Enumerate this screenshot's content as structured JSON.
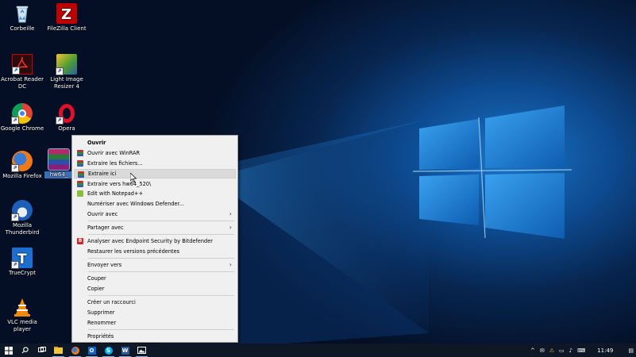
{
  "desktop": {
    "icons": [
      {
        "label": "Corbeille",
        "icon": "recycle-bin-icon"
      },
      {
        "label": "FileZilla Client",
        "icon": "filezilla-icon"
      },
      {
        "label": "Acrobat Reader DC",
        "icon": "acrobat-icon"
      },
      {
        "label": "Light Image Resizer 4",
        "icon": "light-image-resizer-icon"
      },
      {
        "label": "Google Chrome",
        "icon": "chrome-icon"
      },
      {
        "label": "Opera",
        "icon": "opera-icon"
      },
      {
        "label": "Mozilla Firefox",
        "icon": "firefox-icon"
      },
      {
        "label": "hw64_",
        "icon": "winrar-archive-icon"
      },
      {
        "label": "Mozilla Thunderbird",
        "icon": "thunderbird-icon"
      },
      {
        "label": "TrueCrypt",
        "icon": "truecrypt-icon"
      },
      {
        "label": "VLC media player",
        "icon": "vlc-icon"
      }
    ]
  },
  "context_menu": {
    "items": [
      {
        "label": "Ouvrir"
      },
      {
        "label": "Ouvrir avec WinRAR"
      },
      {
        "label": "Extraire les fichiers..."
      },
      {
        "label": "Extraire ici"
      },
      {
        "label": "Extraire vers hw64_520\\"
      },
      {
        "label": "Edit with Notepad++"
      },
      {
        "label": "Numériser avec Windows Defender..."
      },
      {
        "label": "Ouvrir avec"
      },
      {
        "label": "Partager avec"
      },
      {
        "label": "Analyser avec Endpoint Security by Bitdefender"
      },
      {
        "label": "Restaurer les versions précédentes"
      },
      {
        "label": "Envoyer vers"
      },
      {
        "label": "Couper"
      },
      {
        "label": "Copier"
      },
      {
        "label": "Créer un raccourci"
      },
      {
        "label": "Supprimer"
      },
      {
        "label": "Renommer"
      },
      {
        "label": "Propriétés"
      }
    ],
    "hovered": "Extraire ici"
  },
  "taskbar": {
    "clock": "11:49",
    "pinned": [
      "start-icon",
      "search-icon",
      "task-view-icon",
      "file-explorer-icon",
      "firefox-icon",
      "outlook-icon",
      "skype-icon",
      "word-icon",
      "photos-icon"
    ]
  },
  "colors": {
    "wallpaper_light": "#1a76c9",
    "taskbar": "#0d1726",
    "menu_bg": "#f0f0f0",
    "menu_hover": "#dadada"
  }
}
